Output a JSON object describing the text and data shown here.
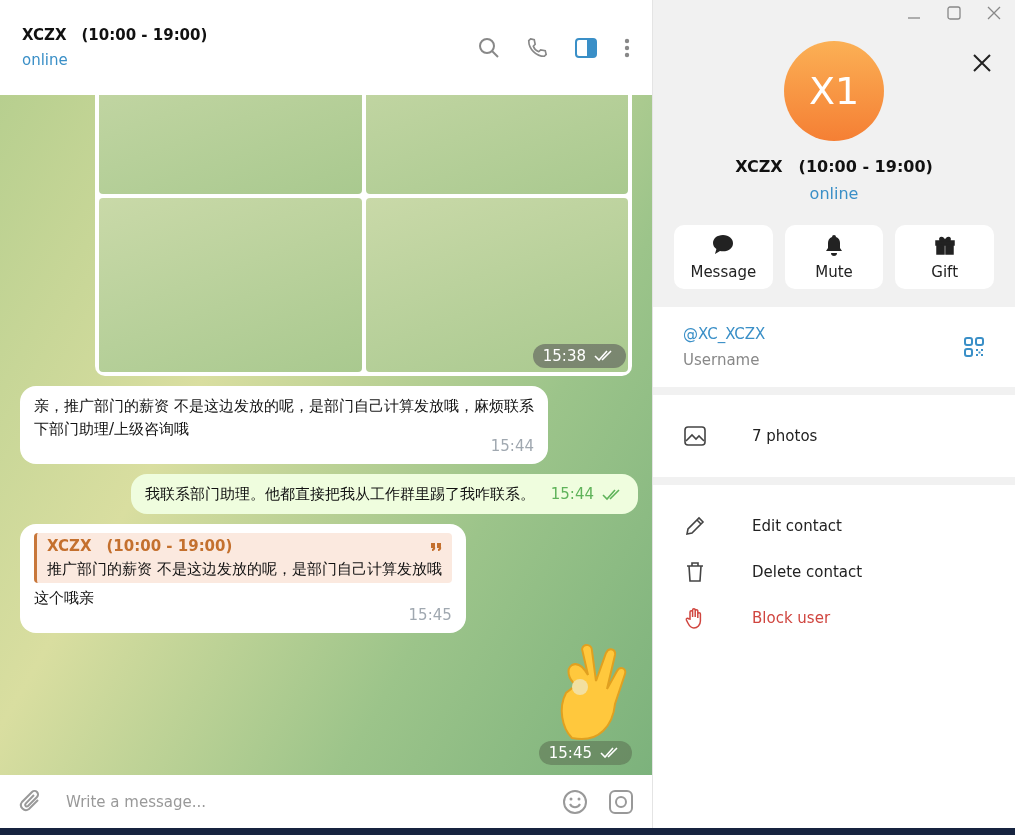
{
  "chat_header": {
    "title": "XCZX　(10:00 - 19:00)",
    "status": "online"
  },
  "messages": [
    {
      "kind": "image",
      "time": "15:38",
      "read": true
    },
    {
      "kind": "incoming",
      "text": "亲，推广部门的薪资 不是这边发放的呢，是部门自己计算发放哦，麻烦联系下部门助理/上级咨询哦",
      "time": "15:44"
    },
    {
      "kind": "outgoing",
      "text": "我联系部门助理。他都直接把我从工作群里踢了我咋联系。",
      "time": "15:44",
      "read": true
    },
    {
      "kind": "reply",
      "quote_author": "XCZX　(10:00 - 19:00)",
      "quote_text": "推广部门的薪资 不是这边发放的呢，是部门自己计算发放哦",
      "text": "这个哦亲",
      "time": "15:45"
    },
    {
      "kind": "sticker",
      "time": "15:45",
      "read": true
    }
  ],
  "composer": {
    "placeholder": "Write a message..."
  },
  "profile": {
    "avatar_initials": "X1",
    "name": "XCZX　(10:00 - 19:00)",
    "status": "online",
    "actions": [
      {
        "kind": "message",
        "label": "Message"
      },
      {
        "kind": "mute",
        "label": "Mute"
      },
      {
        "kind": "gift",
        "label": "Gift"
      }
    ],
    "username": {
      "value": "@XC_XCZX",
      "label": "Username"
    },
    "media": {
      "label": "7 photos"
    },
    "menu": [
      {
        "kind": "edit",
        "label": "Edit contact"
      },
      {
        "kind": "delete",
        "label": "Delete contact"
      },
      {
        "kind": "block",
        "label": "Block user"
      }
    ]
  }
}
